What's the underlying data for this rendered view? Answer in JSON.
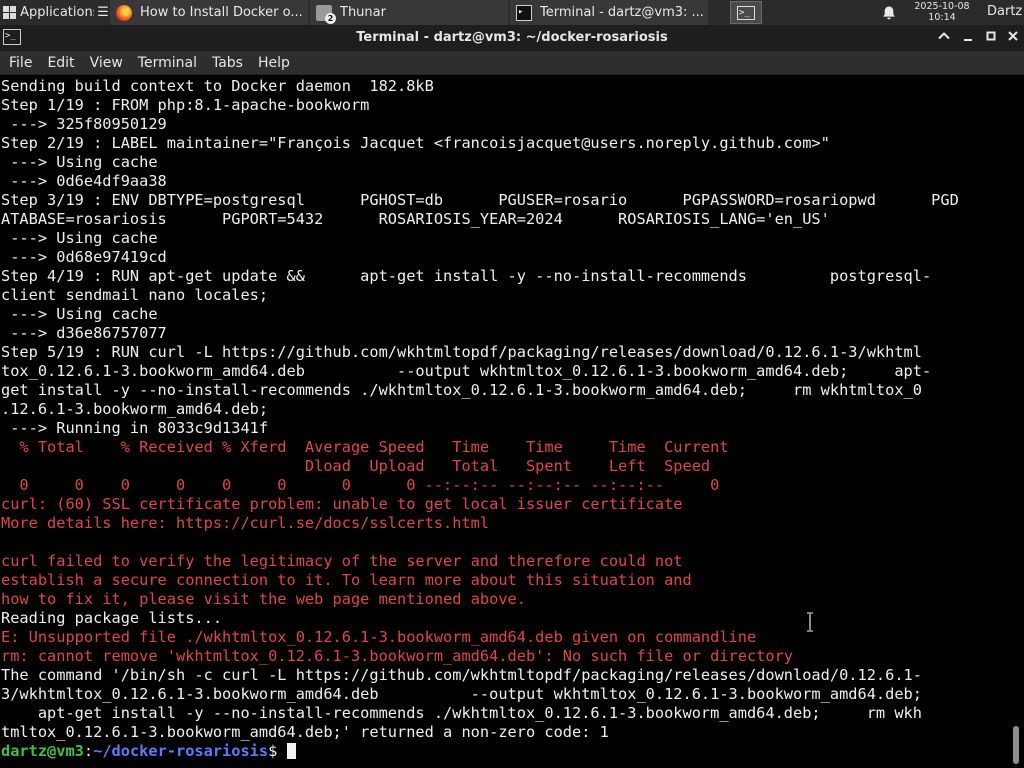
{
  "panel": {
    "apps_label": "Applications",
    "apps_suffix": "☰",
    "tasks": [
      {
        "label": "How to Install Docker o...",
        "icon": "firefox-icon"
      },
      {
        "label": "Thunar",
        "icon": "folder-icon",
        "badge": "2"
      },
      {
        "label": "Terminal - dartz@vm3: ...",
        "icon": "terminal-icon"
      }
    ],
    "launcher_glyph": ">_",
    "clock_date": "2025-10-08",
    "clock_time": "10:14",
    "user": "Dartz"
  },
  "window": {
    "title": "Terminal - dartz@vm3: ~/docker-rosariosis",
    "icon_glyph": ">_"
  },
  "menu": {
    "file": "File",
    "edit": "Edit",
    "view": "View",
    "terminal": "Terminal",
    "tabs": "Tabs",
    "help": "Help"
  },
  "terminal": {
    "lines": [
      {
        "c": "w",
        "t": "Sending build context to Docker daemon  182.8kB"
      },
      {
        "c": "w",
        "t": "Step 1/19 : FROM php:8.1-apache-bookworm"
      },
      {
        "c": "w",
        "t": " ---> 325f80950129"
      },
      {
        "c": "w",
        "t": "Step 2/19 : LABEL maintainer=\"François Jacquet <francoisjacquet@users.noreply.github.com>\""
      },
      {
        "c": "w",
        "t": " ---> Using cache"
      },
      {
        "c": "w",
        "t": " ---> 0d6e4df9aa38"
      },
      {
        "c": "w",
        "t": "Step 3/19 : ENV DBTYPE=postgresql      PGHOST=db      PGUSER=rosario      PGPASSWORD=rosariopwd      PGD"
      },
      {
        "c": "w",
        "t": "ATABASE=rosariosis      PGPORT=5432      ROSARIOSIS_YEAR=2024      ROSARIOSIS_LANG='en_US'"
      },
      {
        "c": "w",
        "t": " ---> Using cache"
      },
      {
        "c": "w",
        "t": " ---> 0d68e97419cd"
      },
      {
        "c": "w",
        "t": "Step 4/19 : RUN apt-get update &&      apt-get install -y --no-install-recommends         postgresql-"
      },
      {
        "c": "w",
        "t": "client sendmail nano locales;"
      },
      {
        "c": "w",
        "t": " ---> Using cache"
      },
      {
        "c": "w",
        "t": " ---> d36e86757077"
      },
      {
        "c": "w",
        "t": "Step 5/19 : RUN curl -L https://github.com/wkhtmltopdf/packaging/releases/download/0.12.6.1-3/wkhtml"
      },
      {
        "c": "w",
        "t": "tox_0.12.6.1-3.bookworm_amd64.deb          --output wkhtmltox_0.12.6.1-3.bookworm_amd64.deb;     apt-"
      },
      {
        "c": "w",
        "t": "get install -y --no-install-recommends ./wkhtmltox_0.12.6.1-3.bookworm_amd64.deb;     rm wkhtmltox_0"
      },
      {
        "c": "w",
        "t": ".12.6.1-3.bookworm_amd64.deb;"
      },
      {
        "c": "w",
        "t": " ---> Running in 8033c9d1341f"
      },
      {
        "c": "r",
        "t": "  % Total    % Received % Xferd  Average Speed   Time    Time     Time  Current"
      },
      {
        "c": "r",
        "t": "                                 Dload  Upload   Total   Spent    Left  Speed"
      },
      {
        "c": "r",
        "t": "  0     0    0     0    0     0      0      0 --:--:-- --:--:-- --:--:--     0"
      },
      {
        "c": "r",
        "t": "curl: (60) SSL certificate problem: unable to get local issuer certificate"
      },
      {
        "c": "r",
        "t": "More details here: https://curl.se/docs/sslcerts.html"
      },
      {
        "c": "r",
        "t": ""
      },
      {
        "c": "r",
        "t": "curl failed to verify the legitimacy of the server and therefore could not"
      },
      {
        "c": "r",
        "t": "establish a secure connection to it. To learn more about this situation and"
      },
      {
        "c": "r",
        "t": "how to fix it, please visit the web page mentioned above."
      },
      {
        "c": "w",
        "t": "Reading package lists..."
      },
      {
        "c": "r",
        "t": "E: Unsupported file ./wkhtmltox_0.12.6.1-3.bookworm_amd64.deb given on commandline"
      },
      {
        "c": "r",
        "t": "rm: cannot remove 'wkhtmltox_0.12.6.1-3.bookworm_amd64.deb': No such file or directory"
      },
      {
        "c": "w",
        "t": "The command '/bin/sh -c curl -L https://github.com/wkhtmltopdf/packaging/releases/download/0.12.6.1-"
      },
      {
        "c": "w",
        "t": "3/wkhtmltox_0.12.6.1-3.bookworm_amd64.deb          --output wkhtmltox_0.12.6.1-3.bookworm_amd64.deb;"
      },
      {
        "c": "w",
        "t": "    apt-get install -y --no-install-recommends ./wkhtmltox_0.12.6.1-3.bookworm_amd64.deb;     rm wkh"
      },
      {
        "c": "w",
        "t": "tmltox_0.12.6.1-3.bookworm_amd64.deb;' returned a non-zero code: 1"
      }
    ],
    "prompt_user": "dartz@vm3",
    "prompt_sep": ":",
    "prompt_path": "~/docker-rosariosis",
    "prompt_symbol": "$ "
  },
  "colors": {
    "error_text": "#e0444b",
    "prompt_user": "#3ec13e",
    "prompt_path": "#5a7cff"
  }
}
